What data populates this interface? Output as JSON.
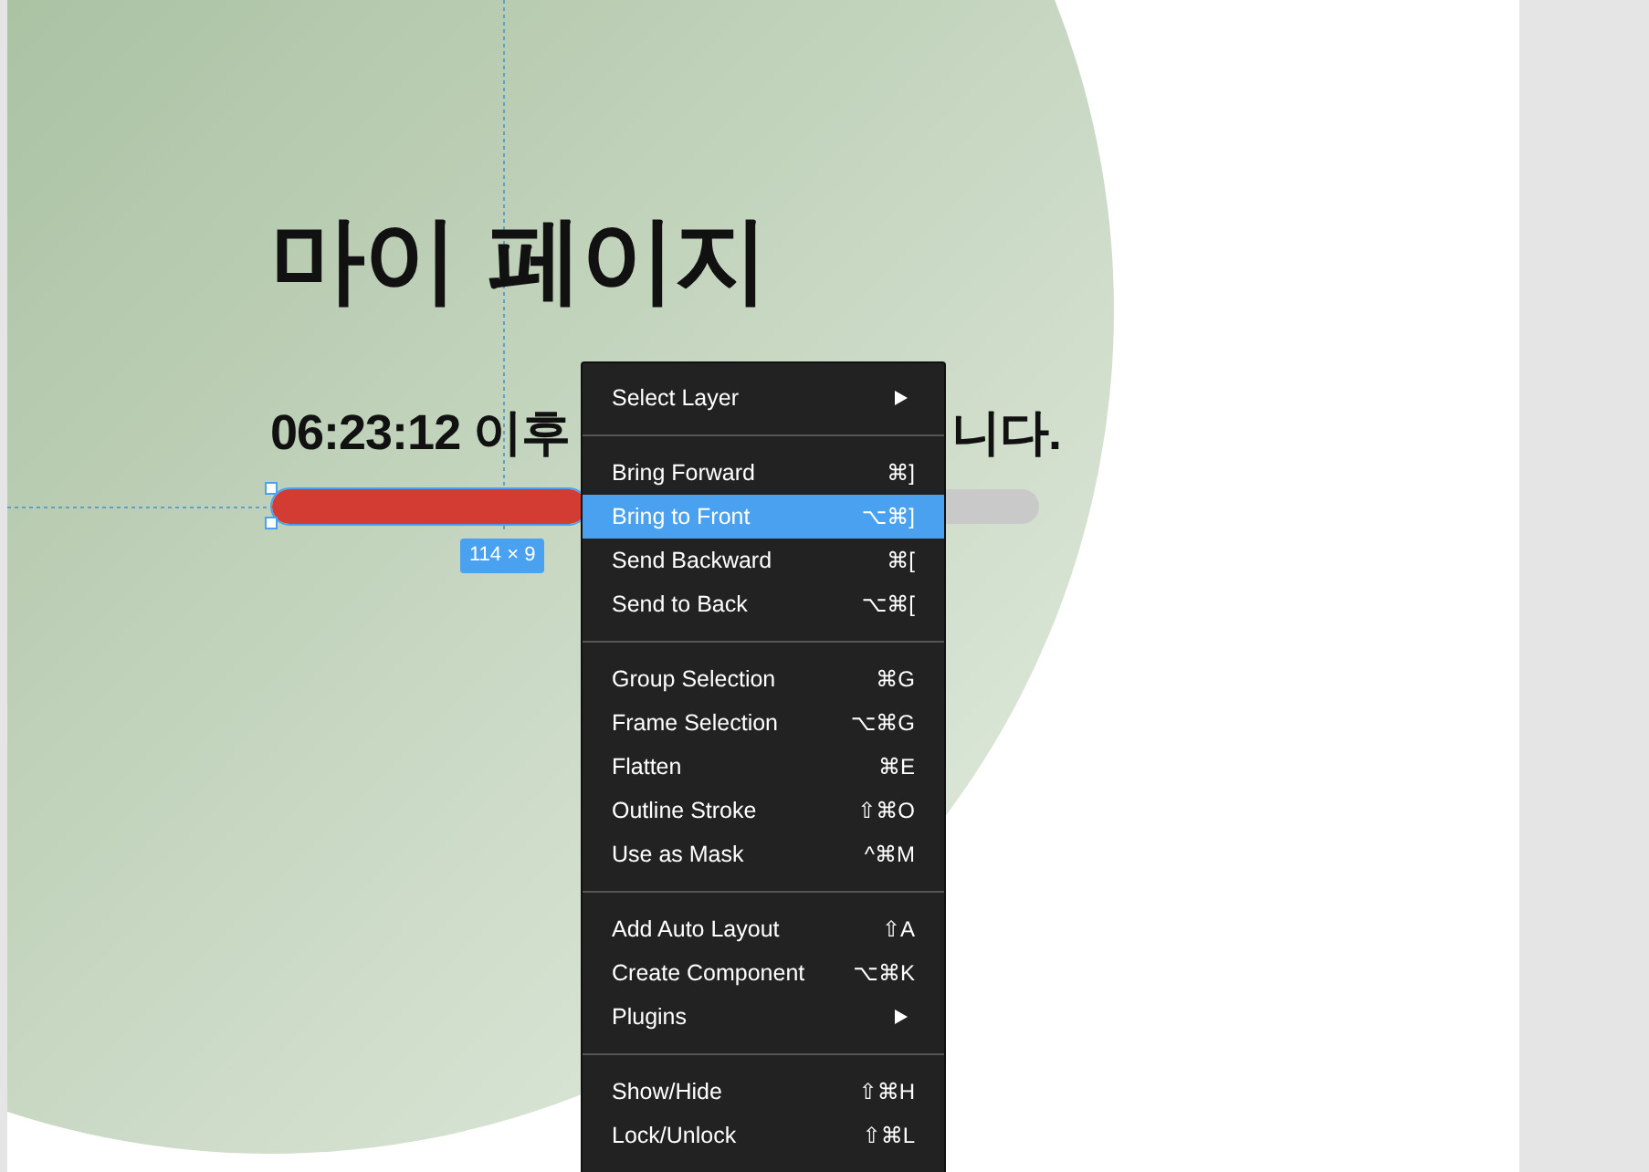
{
  "canvas": {
    "heading": "마이 페이지",
    "subtitle_visible": [
      "06:23:12 이후",
      "니다."
    ],
    "progress": {
      "level": 0.41,
      "selected": true
    },
    "size_label": "114 × 9"
  },
  "context_menu": {
    "groups": [
      {
        "items": [
          {
            "label": "Select Layer",
            "submenu": true,
            "selected": false
          }
        ]
      },
      {
        "items": [
          {
            "label": "Bring Forward",
            "shortcut": "⌘]",
            "selected": false
          },
          {
            "label": "Bring to Front",
            "shortcut": "⌥⌘]",
            "selected": true
          },
          {
            "label": "Send Backward",
            "shortcut": "⌘[",
            "selected": false
          },
          {
            "label": "Send to Back",
            "shortcut": "⌥⌘[",
            "selected": false
          }
        ]
      },
      {
        "items": [
          {
            "label": "Group Selection",
            "shortcut": "⌘G",
            "selected": false
          },
          {
            "label": "Frame Selection",
            "shortcut": "⌥⌘G",
            "selected": false
          },
          {
            "label": "Flatten",
            "shortcut": "⌘E",
            "selected": false
          },
          {
            "label": "Outline Stroke",
            "shortcut": "⇧⌘O",
            "selected": false
          },
          {
            "label": "Use as Mask",
            "shortcut": "^⌘M",
            "selected": false
          }
        ]
      },
      {
        "items": [
          {
            "label": "Add Auto Layout",
            "shortcut": "⇧A",
            "selected": false
          },
          {
            "label": "Create Component",
            "shortcut": "⌥⌘K",
            "selected": false
          },
          {
            "label": "Plugins",
            "submenu": true,
            "selected": false
          }
        ]
      },
      {
        "items": [
          {
            "label": "Show/Hide",
            "shortcut": "⇧⌘H",
            "selected": false
          },
          {
            "label": "Lock/Unlock",
            "shortcut": "⇧⌘L",
            "selected": false
          }
        ]
      }
    ]
  }
}
